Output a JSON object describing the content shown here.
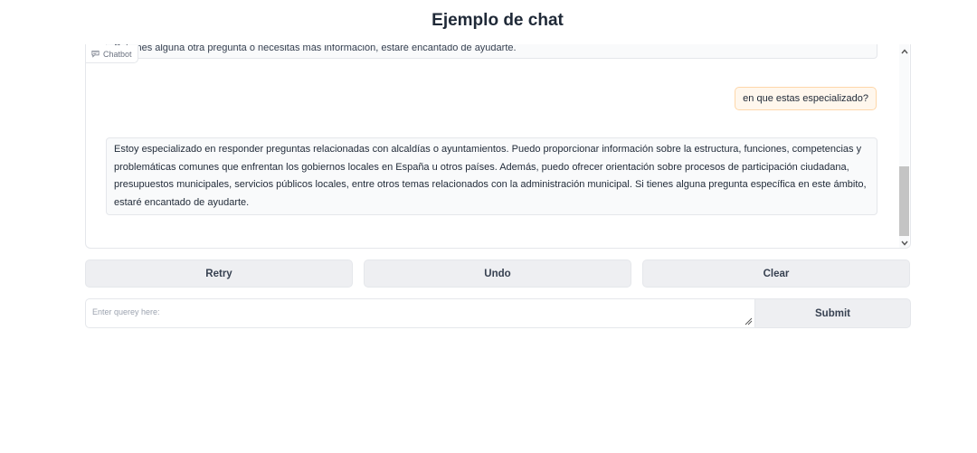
{
  "page": {
    "title": "Ejemplo de chat"
  },
  "chatbot": {
    "label": "Chatbot",
    "messages": [
      {
        "role": "bot",
        "text": "Si tienes alguna otra pregunta o necesitas más información, estaré encantado de ayudarte."
      },
      {
        "role": "user",
        "text": "en que estas especializado?"
      },
      {
        "role": "bot",
        "text": "Estoy especializado en responder preguntas relacionadas con alcaldías o ayuntamientos. Puedo proporcionar información sobre la estructura, funciones, competencias y problemáticas comunes que enfrentan los gobiernos locales en España u otros países. Además, puedo ofrecer orientación sobre procesos de participación ciudadana, presupuestos municipales, servicios públicos locales, entre otros temas relacionados con la administración municipal. Si tienes alguna pregunta específica en este ámbito, estaré encantado de ayudarte."
      }
    ]
  },
  "actions": {
    "retry": "Retry",
    "undo": "Undo",
    "clear": "Clear"
  },
  "input": {
    "placeholder": "Enter querey here:",
    "value": "",
    "submit": "Submit"
  },
  "icons": {
    "chatbot": "chat-bubble-icon",
    "scroll_up": "chevron-up-icon",
    "scroll_down": "chevron-down-icon",
    "resize": "resize-grip-icon"
  },
  "colors": {
    "user_bubble_bg": "#fff7ed",
    "user_bubble_border": "#fed7aa",
    "bot_bubble_bg": "#f9fafb",
    "button_bg": "#eeeff2"
  }
}
